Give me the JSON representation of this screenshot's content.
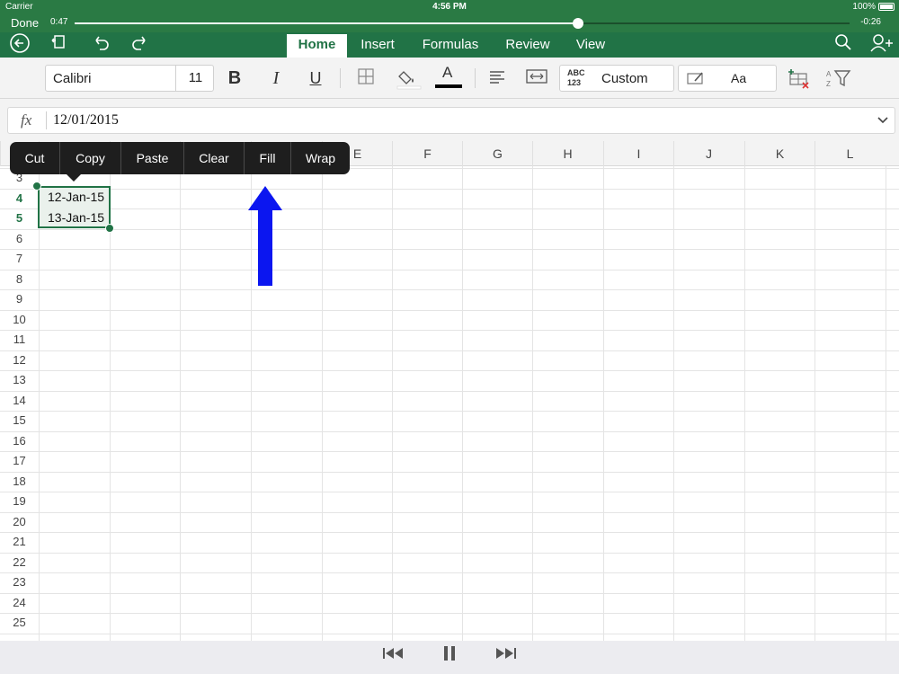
{
  "status_bar": {
    "carrier": "Carrier",
    "time": "4:56 PM",
    "battery": "100%"
  },
  "player": {
    "done_label": "Done",
    "elapsed": "0:47",
    "remaining": "-0:26",
    "progress": 0.65
  },
  "ribbon": {
    "tabs": [
      {
        "label": "Home",
        "active": true
      },
      {
        "label": "Insert",
        "active": false
      },
      {
        "label": "Formulas",
        "active": false
      },
      {
        "label": "Review",
        "active": false
      },
      {
        "label": "View",
        "active": false
      }
    ],
    "icons": [
      "back-icon",
      "file-icon",
      "undo-icon",
      "redo-icon",
      "search-icon",
      "share-icon"
    ]
  },
  "toolbar": {
    "font_name": "Calibri",
    "font_size": "11",
    "bold": "B",
    "italic": "I",
    "underline": "U",
    "font_color_letter": "A",
    "number_format_abc": "ABC",
    "number_format_123": "123",
    "number_format": "Custom",
    "cell_styles": "Aa"
  },
  "formula_bar": {
    "fx": "fx",
    "value": "12/01/2015"
  },
  "grid": {
    "columns": [
      "E",
      "F",
      "G",
      "H",
      "I",
      "J",
      "K",
      "L"
    ],
    "rows": [
      "3",
      "4",
      "5",
      "6",
      "7",
      "8",
      "9",
      "10",
      "11",
      "12",
      "13",
      "14",
      "15",
      "16",
      "17",
      "18",
      "19",
      "20",
      "21",
      "22",
      "23",
      "24",
      "25"
    ],
    "selected_rows": [
      "4",
      "5"
    ],
    "cells": {
      "A4": "12-Jan-15",
      "A5": "13-Jan-15"
    }
  },
  "context_menu": [
    "Cut",
    "Copy",
    "Paste",
    "Clear",
    "Fill",
    "Wrap"
  ],
  "colors": {
    "excel_green": "#217346",
    "annotation_arrow": "#0b16f0"
  }
}
